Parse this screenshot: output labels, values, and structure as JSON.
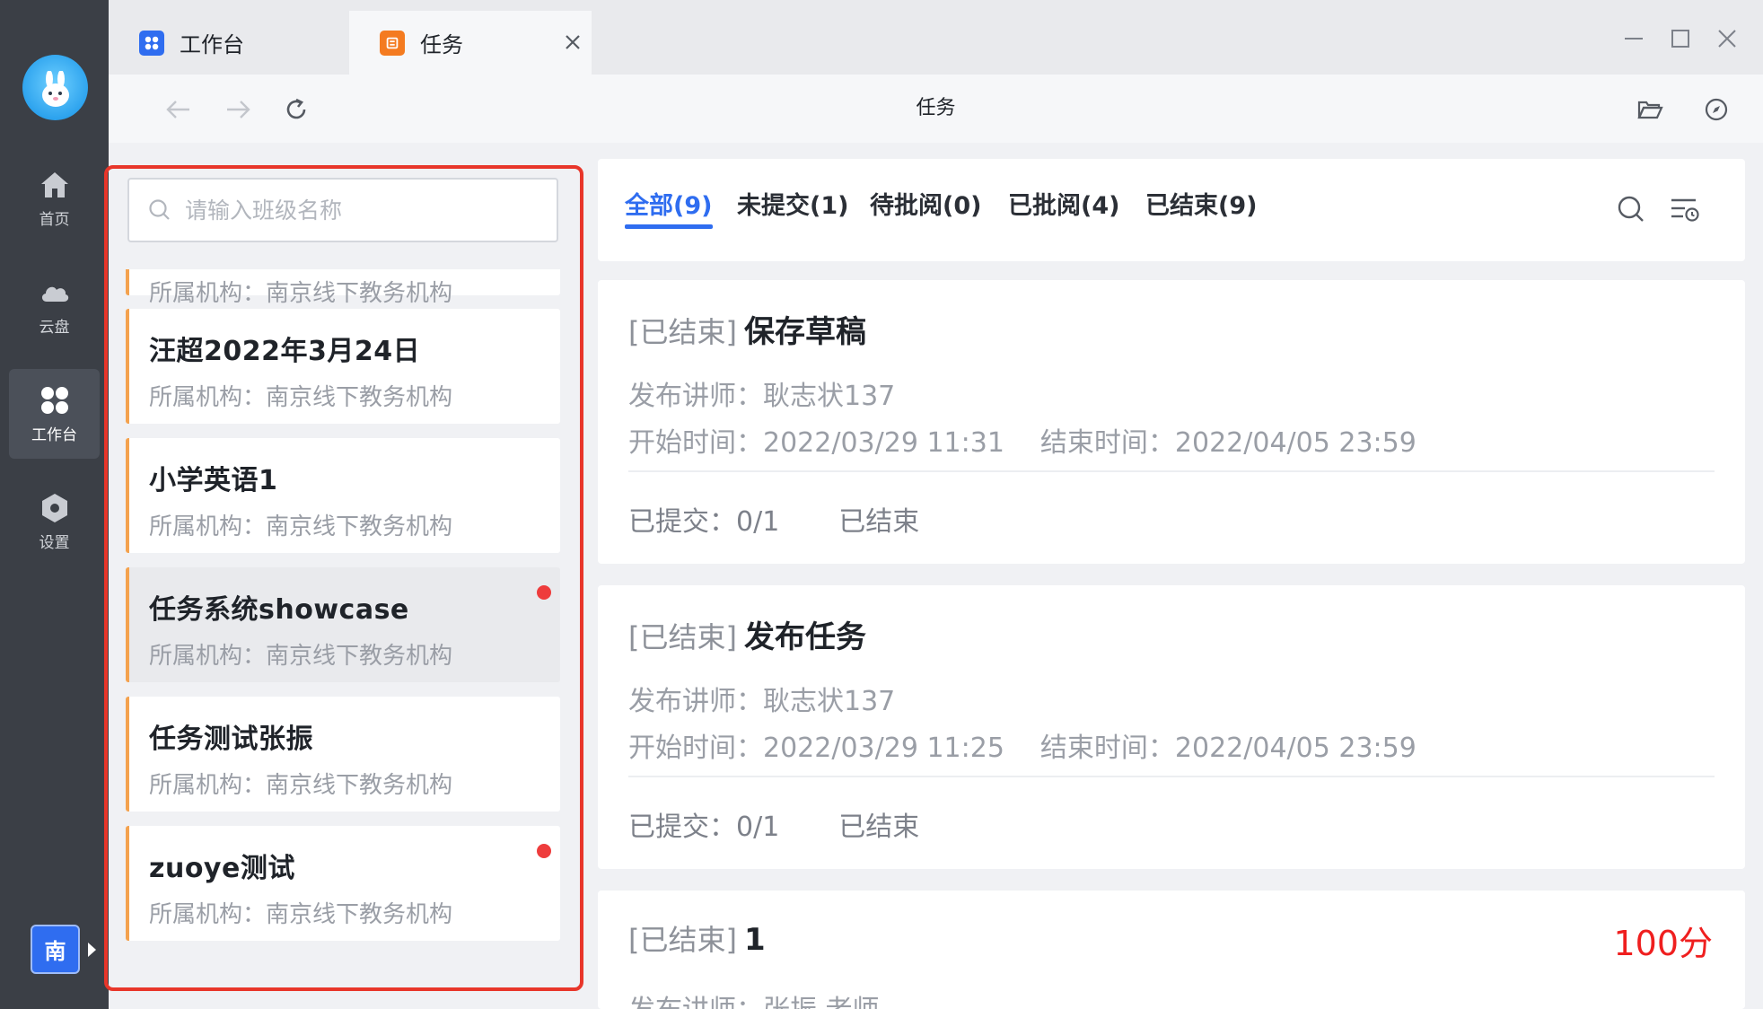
{
  "rail": {
    "items": [
      {
        "label": "首页"
      },
      {
        "label": "云盘"
      },
      {
        "label": "工作台"
      },
      {
        "label": "设置"
      }
    ],
    "org_badge": "南"
  },
  "tabs": [
    {
      "title": "工作台"
    },
    {
      "title": "任务"
    }
  ],
  "toolbar": {
    "title": "任务"
  },
  "class_panel": {
    "search_placeholder": "请输入班级名称",
    "partial_org": "所属机构：南京线下教务机构",
    "classes": [
      {
        "name": "汪超2022年3月24日",
        "org": "所属机构：南京线下教务机构"
      },
      {
        "name": "小学英语1",
        "org": "所属机构：南京线下教务机构"
      },
      {
        "name": "任务系统showcase",
        "org": "所属机构：南京线下教务机构"
      },
      {
        "name": "任务测试张振",
        "org": "所属机构：南京线下教务机构"
      },
      {
        "name": "zuoye测试",
        "org": "所属机构：南京线下教务机构"
      }
    ]
  },
  "filters": [
    {
      "label": "全部(9)"
    },
    {
      "label": "未提交(1)"
    },
    {
      "label": "待批阅(0)"
    },
    {
      "label": "已批阅(4)"
    },
    {
      "label": "已结束(9)"
    }
  ],
  "tasks": [
    {
      "status": "[已结束]",
      "title": "保存草稿",
      "teacher": "发布讲师：耿志状137",
      "start": "开始时间：2022/03/29 11:31",
      "end": "结束时间：2022/04/05 23:59",
      "submitted": "已提交：0/1",
      "state": "已结束"
    },
    {
      "status": "[已结束]",
      "title": "发布任务",
      "teacher": "发布讲师：耿志状137",
      "start": "开始时间：2022/03/29 11:25",
      "end": "结束时间：2022/04/05 23:59",
      "submitted": "已提交：0/1",
      "state": "已结束"
    },
    {
      "status": "[已结束]",
      "title": "1",
      "score": "100分",
      "teacher": "发布讲师：张振 老师"
    }
  ]
}
